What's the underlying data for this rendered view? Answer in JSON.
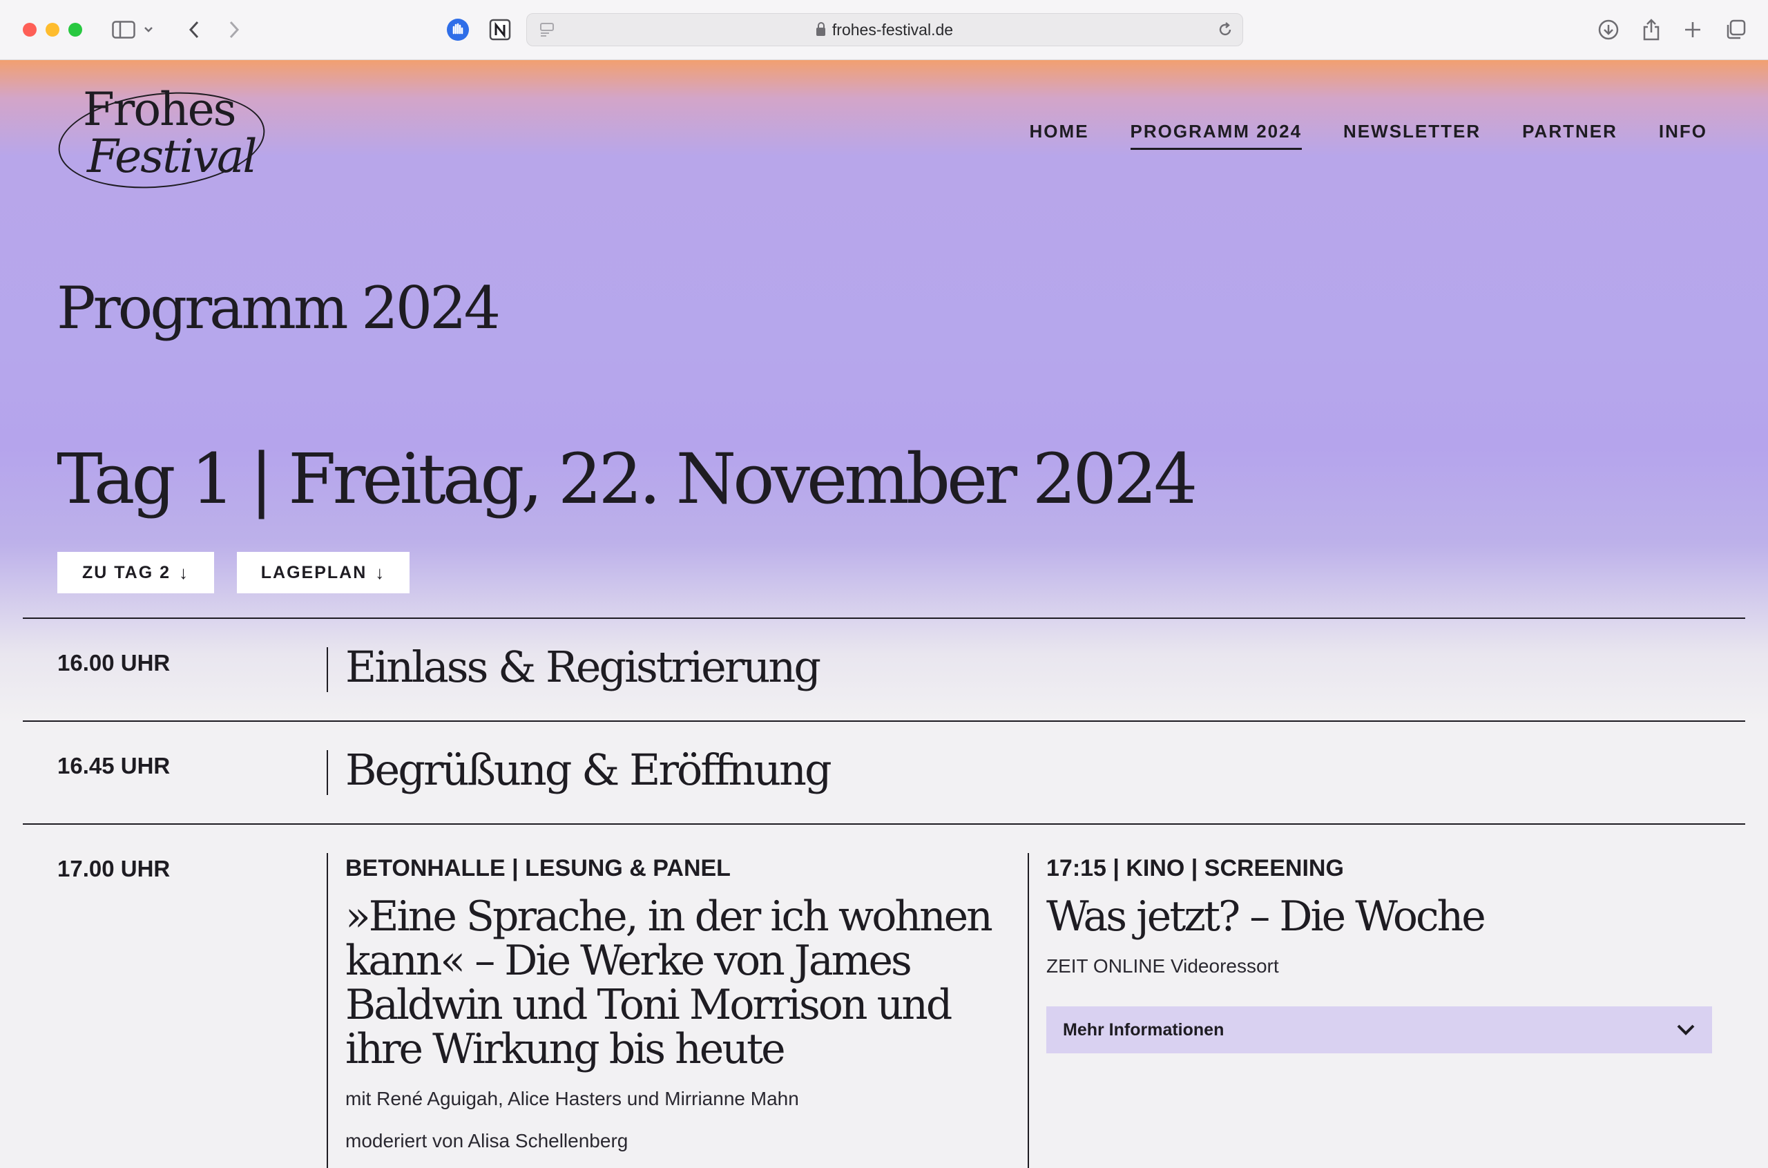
{
  "browser": {
    "url": "frohes-festival.de"
  },
  "logo": {
    "line1": "Frohes",
    "line2": "Festival"
  },
  "nav": {
    "home": "HOME",
    "programm": "PROGRAMM 2024",
    "newsletter": "NEWSLETTER",
    "partner": "PARTNER",
    "info": "INFO"
  },
  "page_title": "Programm 2024",
  "day_title": "Tag 1 | Freitag, 22. November 2024",
  "buttons": {
    "tag2": "ZU TAG 2",
    "lageplan": "LAGEPLAN"
  },
  "schedule": [
    {
      "time": "16.00 UHR",
      "title": "Einlass & Registrierung"
    },
    {
      "time": "16.45 UHR",
      "title": "Begrüßung & Eröffnung"
    },
    {
      "time": "17.00 UHR"
    }
  ],
  "event_left": {
    "meta": "BETONHALLE | LESUNG & PANEL",
    "title": "»Eine Sprache, in der ich wohnen kann« – Die Werke von James Baldwin und Toni Morrison und ihre Wirkung bis heute",
    "guests": "mit René Aguigah, Alice Hasters und Mirrianne Mahn",
    "moderation": "moderiert von Alisa Schellenberg"
  },
  "event_right": {
    "meta": "17:15 | KINO | SCREENING",
    "title": "Was jetzt? – Die Woche",
    "subtitle": "ZEIT ONLINE Videoressort",
    "more": "Mehr Informationen"
  }
}
